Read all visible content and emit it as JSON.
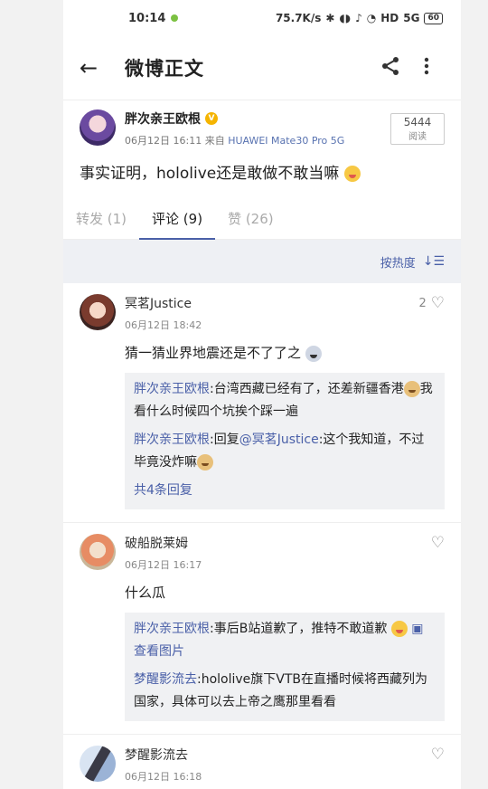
{
  "status": {
    "time": "10:14",
    "speed": "75.7K/s",
    "battery": "60",
    "signal": "5G"
  },
  "appbar": {
    "title": "微博正文"
  },
  "post": {
    "author": "胖次亲王欧根",
    "date": "06月12日 16:11",
    "from_label": "来自",
    "device": "HUAWEI Mate30 Pro 5G",
    "reads": "5444",
    "reads_label": "阅读",
    "text": "事实证明，hololive还是敢做不敢当嘛"
  },
  "tabs": [
    {
      "label": "转发 (1)"
    },
    {
      "label": "评论 (9)"
    },
    {
      "label": "赞 (26)"
    }
  ],
  "sort": {
    "label": "按热度"
  },
  "comments": [
    {
      "name": "冥茗Justice",
      "time": "06月12日 18:42",
      "likes": "2",
      "text": "猜一猜业界地震还是不了了之",
      "replies": [
        {
          "user": "胖次亲王欧根",
          "text": ":台湾西藏已经有了，还差新疆香港",
          "text2": "我看什么时候四个坑挨个踩一遍"
        },
        {
          "user": "胖次亲王欧根",
          "text": ":回复",
          "mention": "@冥茗Justice",
          "text2": ":这个我知道，不过毕竟没炸嘛"
        }
      ],
      "more": "共4条回复"
    },
    {
      "name": "破船脱莱姆",
      "time": "06月12日 16:17",
      "text": "什么瓜",
      "replies": [
        {
          "user": "胖次亲王欧根",
          "text": ":事后B站道歉了，推特不敢道歉",
          "view_pic": "查看图片"
        },
        {
          "user": "梦醒影流去",
          "text": ":hololive旗下VTB在直播时候将西藏列为国家，具体可以去上帝之鹰那里看看"
        }
      ]
    },
    {
      "name": "梦醒影流去",
      "time": "06月12日 16:18"
    }
  ]
}
